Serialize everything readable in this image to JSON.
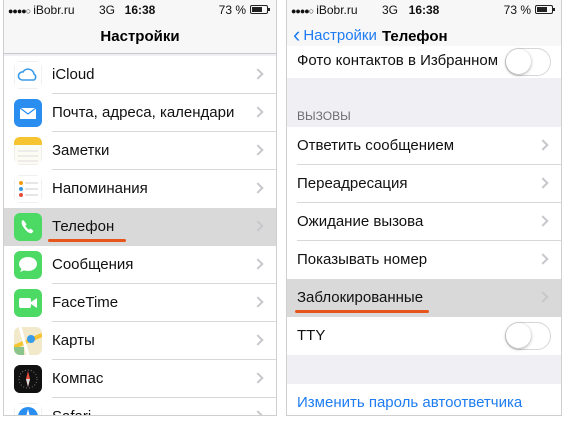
{
  "left_screen": {
    "status": {
      "carrier": "iBobr.ru",
      "network": "3G",
      "time": "16:38",
      "battery": "73 %",
      "battery_level": 0.73
    },
    "nav_title": "Настройки",
    "items": [
      {
        "label": "iCloud",
        "icon": "icloud-icon"
      },
      {
        "label": "Почта, адреса, календари",
        "icon": "mail-icon"
      },
      {
        "label": "Заметки",
        "icon": "notes-icon"
      },
      {
        "label": "Напоминания",
        "icon": "reminders-icon"
      },
      {
        "label": "Телефон",
        "icon": "phone-icon",
        "selected": true
      },
      {
        "label": "Сообщения",
        "icon": "messages-icon"
      },
      {
        "label": "FaceTime",
        "icon": "facetime-icon"
      },
      {
        "label": "Карты",
        "icon": "maps-icon"
      },
      {
        "label": "Компас",
        "icon": "compass-icon"
      },
      {
        "label": "Safari",
        "icon": "safari-icon"
      }
    ]
  },
  "right_screen": {
    "status": {
      "carrier": "iBobr.ru",
      "network": "3G",
      "time": "16:38",
      "battery": "73 %",
      "battery_level": 0.73
    },
    "nav_back": "Настройки",
    "nav_title": "Телефон",
    "top_row": {
      "label": "Фото контактов в Избранном",
      "toggle_on": false
    },
    "section_header": "ВЫЗОВЫ",
    "calls_items": [
      {
        "label": "Ответить сообщением"
      },
      {
        "label": "Переадресация"
      },
      {
        "label": "Ожидание вызова"
      },
      {
        "label": "Показывать номер"
      },
      {
        "label": "Заблокированные",
        "selected": true
      }
    ],
    "tty_label": "TTY",
    "tty_on": false,
    "voicemail_link": "Изменить пароль автоответчика"
  },
  "colors": {
    "accent": "#1e7cf2",
    "highlight_underline": "#e8551a"
  }
}
